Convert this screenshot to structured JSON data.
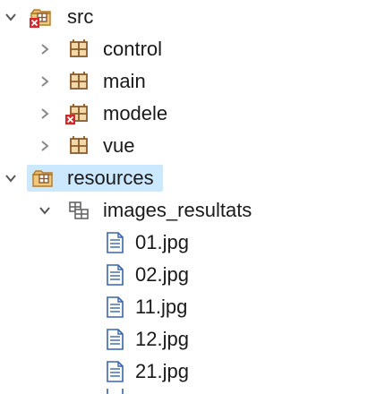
{
  "tree": {
    "items": [
      {
        "label": "src",
        "icon": "source-folder-error-icon",
        "expanded": true
      },
      {
        "label": "control",
        "icon": "package-icon",
        "expanded": false
      },
      {
        "label": "main",
        "icon": "package-icon",
        "expanded": false
      },
      {
        "label": "modele",
        "icon": "package-error-icon",
        "expanded": false
      },
      {
        "label": "vue",
        "icon": "package-icon",
        "expanded": false
      },
      {
        "label": "resources",
        "icon": "source-folder-icon",
        "expanded": true,
        "selected": true
      },
      {
        "label": "images_resultats",
        "icon": "folder-package-icon",
        "expanded": true
      },
      {
        "label": "01.jpg",
        "icon": "file-icon"
      },
      {
        "label": "02.jpg",
        "icon": "file-icon"
      },
      {
        "label": "11.jpg",
        "icon": "file-icon"
      },
      {
        "label": "12.jpg",
        "icon": "file-icon"
      },
      {
        "label": "21.jpg",
        "icon": "file-icon"
      }
    ]
  },
  "colors": {
    "selection": "#cce8ff",
    "package_brown": "#8a5a2b",
    "folder_tan": "#e8b96a",
    "error_red": "#d9262e",
    "file_blue": "#3a66a8"
  }
}
